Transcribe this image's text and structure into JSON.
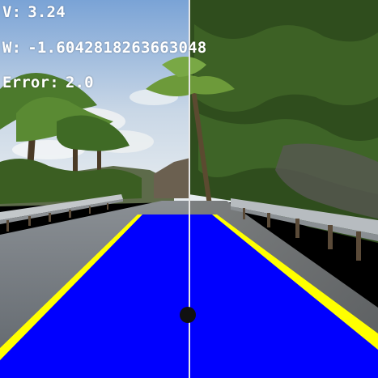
{
  "telemetry": {
    "v_label": "V:",
    "v_value": "3.24",
    "w_label": "W:",
    "w_value": "-1.6042818263663048",
    "error_label": "Error:",
    "error_value": "2.0"
  },
  "scene": {
    "description_icon": "road-camera-view",
    "lane_mask_color": "#0000ff",
    "lane_border_color": "#ffff00",
    "center_line_color": "#e6e6e6",
    "target_dot_color": "#111111",
    "sky_color_top": "#7ea5d8",
    "sky_color_bottom": "#dfe7ee",
    "road_color": "#6f7479",
    "foliage_color": "#3a5e22",
    "guardrail_color": "#b9bec3"
  }
}
